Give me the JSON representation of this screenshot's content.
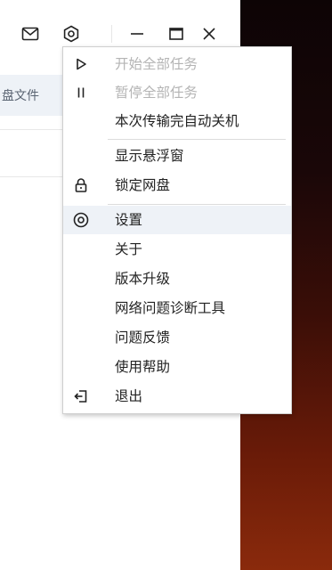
{
  "window": {
    "visible_text": "盘文件"
  },
  "menu": {
    "items": [
      {
        "label": "开始全部任务",
        "icon": "play-icon",
        "disabled": true
      },
      {
        "label": "暂停全部任务",
        "icon": "pause-icon",
        "disabled": true
      },
      {
        "label": "本次传输完自动关机",
        "icon": "",
        "disabled": false
      },
      {
        "label": "显示悬浮窗",
        "icon": "",
        "disabled": false
      },
      {
        "label": "锁定网盘",
        "icon": "lock-icon",
        "disabled": false
      },
      {
        "label": "设置",
        "icon": "settings-icon",
        "disabled": false,
        "active": true
      },
      {
        "label": "关于",
        "icon": "",
        "disabled": false
      },
      {
        "label": "版本升级",
        "icon": "",
        "disabled": false
      },
      {
        "label": "网络问题诊断工具",
        "icon": "",
        "disabled": false
      },
      {
        "label": "问题反馈",
        "icon": "",
        "disabled": false
      },
      {
        "label": "使用帮助",
        "icon": "",
        "disabled": false
      },
      {
        "label": "退出",
        "icon": "exit-icon",
        "disabled": false
      }
    ]
  },
  "colors": {
    "menu_hover": "#eef2f7",
    "disabled_text": "#b4b4b4",
    "text": "#222222"
  }
}
